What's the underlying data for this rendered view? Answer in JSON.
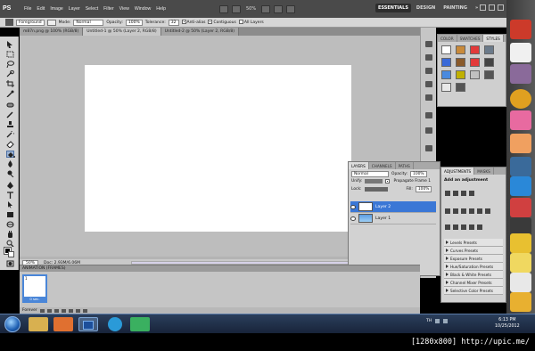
{
  "app": {
    "logo": "PS",
    "menu": [
      "File",
      "Edit",
      "Image",
      "Layer",
      "Select",
      "Filter",
      "View",
      "Window",
      "Help"
    ],
    "zoom": "50%",
    "workspaces": [
      "ESSENTIALS",
      "DESIGN",
      "PAINTING"
    ],
    "workspace_more": "»"
  },
  "options": {
    "preset": "Foreground",
    "mode_label": "Mode:",
    "mode_value": "Normal",
    "opacity_label": "Opacity:",
    "opacity_value": "100%",
    "tolerance_label": "Tolerance:",
    "tolerance_value": "32",
    "antialias": "Anti-alias",
    "contiguous": "Contiguous",
    "all_layers": "All Layers"
  },
  "tabs": [
    "m87n.png @ 100% (RGB/8)",
    "Untitled-1 @ 50% (Layer 2, RGB/8)",
    "Untitled-2 @ 50% (Layer 2, RGB/8)"
  ],
  "status": {
    "zoom": "50%",
    "doc": "Doc: 2.93M/6.06M"
  },
  "styles_panel": {
    "tabs": [
      "COLOR",
      "SWATCHES",
      "STYLES"
    ],
    "swatch_colors": [
      "#ffffff",
      "#c98a3a",
      "#e23a3a",
      "#6b7a8a",
      "#3a6ad8",
      "#8a5a2a",
      "#e23a3a",
      "#444444",
      "#4a8adf",
      "#c0b000",
      "#c0c0c0",
      "#555555",
      "#e8e8e8",
      "#555555"
    ]
  },
  "layers_panel": {
    "tabs": [
      "LAYERS",
      "CHANNELS",
      "PATHS"
    ],
    "blend": "Normal",
    "opacity_label": "Opacity:",
    "opacity": "100%",
    "unify": "Unify:",
    "propagate": "Propagate Frame 1",
    "lock": "Lock:",
    "fill_label": "Fill:",
    "fill": "100%",
    "layers": [
      {
        "name": "Layer 2",
        "selected": true
      },
      {
        "name": "Layer 1",
        "selected": false
      }
    ]
  },
  "adjustments_panel": {
    "tabs": [
      "ADJUSTMENTS",
      "MASKS"
    ],
    "title": "Add an adjustment",
    "presets": [
      "Levels Presets",
      "Curves Presets",
      "Exposure Presets",
      "Hue/Saturation Presets",
      "Black & White Presets",
      "Channel Mixer Presets",
      "Selective Color Presets"
    ]
  },
  "animation_panel": {
    "title": "ANIMATION (FRAMES)",
    "frame_number": "1",
    "frame_time": "0 sec.",
    "loop": "Forever"
  },
  "taskbar": {
    "tray": "TH",
    "time": "6:13 PM",
    "date": "10/25/2012"
  },
  "footer": {
    "text": "[1280x800] http://upic.me/"
  }
}
